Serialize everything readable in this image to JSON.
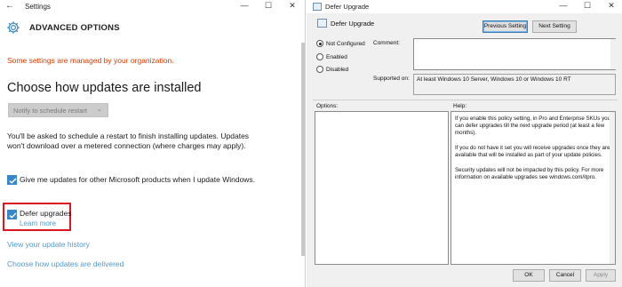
{
  "settings_window": {
    "title": "Settings",
    "back_glyph": "←",
    "controls": {
      "minimize": "—",
      "maximize": "☐",
      "close": "✕"
    },
    "header_icon": "gear-icon",
    "header_title": "ADVANCED OPTIONS",
    "org_notice": "Some settings are managed by your organization.",
    "heading": "Choose how updates are installed",
    "dropdown": {
      "selected": "Notify to schedule restart",
      "chevron": "⌄",
      "disabled": true
    },
    "restart_info": "You'll be asked to schedule a restart to finish installing updates. Updates won't download over a metered connection (where charges may apply).",
    "other_products_checkbox": {
      "label": "Give me updates for other Microsoft products when I update Windows.",
      "checked": true
    },
    "defer_checkbox": {
      "label": "Defer upgrades",
      "checked": true,
      "learn_more": "Learn more"
    },
    "links": {
      "history": "View your update history",
      "delivery": "Choose how updates are delivered"
    },
    "colors": {
      "accent": "#3b86c6",
      "link": "#4f9ad5",
      "warning": "#d83b01",
      "highlight": "#e0141e"
    }
  },
  "policy_window": {
    "title": "Defer Upgrade",
    "controls": {
      "minimize": "—",
      "maximize": "☐",
      "close": "✕"
    },
    "policy_name": "Defer Upgrade",
    "buttons": {
      "previous": "Previous Setting",
      "next": "Next Setting"
    },
    "options": [
      {
        "label": "Not Configured",
        "selected": true
      },
      {
        "label": "Enabled",
        "selected": false
      },
      {
        "label": "Disabled",
        "selected": false
      }
    ],
    "comment_label": "Comment:",
    "supported_label": "Supported on:",
    "supported_value": "At least Windows 10 Server, Windows 10 or Windows 10 RT",
    "options_label": "Options:",
    "help_label": "Help:",
    "help_text": [
      "If you enable this policy setting, in Pro and Enterprise SKUs you can defer upgrades till the next upgrade period (at least a few months).",
      "If you do not have it set you will receive upgrades once they are available that will be installed as part of your update policies.",
      "Security updates will not be impacted by this policy. For more information on available upgrades see windows.com/itpro."
    ],
    "footer_buttons": {
      "ok": "OK",
      "cancel": "Cancel",
      "apply": "Apply"
    }
  }
}
